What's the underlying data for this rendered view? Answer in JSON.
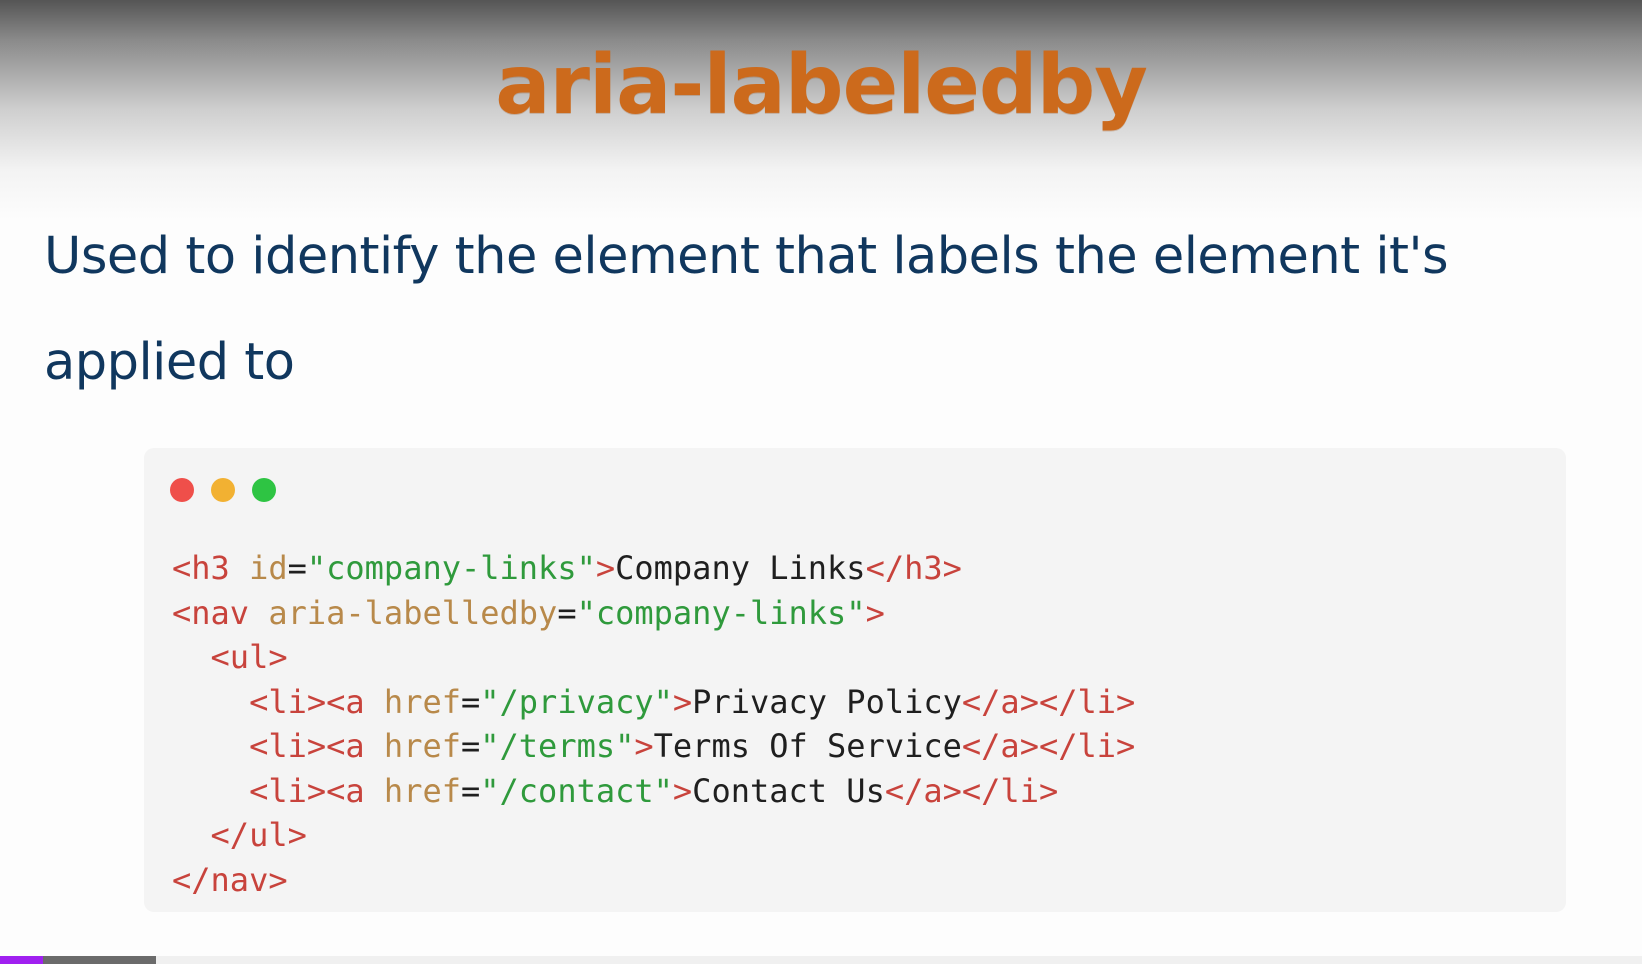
{
  "slide": {
    "title": "aria-labeledby",
    "description": "Used to identify the element that labels the element it's applied to"
  },
  "code_window": {
    "dots": [
      "red-dot",
      "yellow-dot",
      "green-dot"
    ],
    "colors": {
      "tag": "#c8433c",
      "attribute": "#b8894a",
      "string": "#2f9a3c",
      "text": "#1f1f1f"
    },
    "lines": [
      [
        {
          "k": "t",
          "v": "<h3 "
        },
        {
          "k": "a",
          "v": "id"
        },
        {
          "k": "p",
          "v": "="
        },
        {
          "k": "s",
          "v": "\"company-links\""
        },
        {
          "k": "t",
          "v": ">"
        },
        {
          "k": "x",
          "v": "Company Links"
        },
        {
          "k": "t",
          "v": "</h3>"
        }
      ],
      [
        {
          "k": "t",
          "v": "<nav "
        },
        {
          "k": "a",
          "v": "aria-labelledby"
        },
        {
          "k": "p",
          "v": "="
        },
        {
          "k": "s",
          "v": "\"company-links\""
        },
        {
          "k": "t",
          "v": ">"
        }
      ],
      [
        {
          "k": "x",
          "v": "  "
        },
        {
          "k": "t",
          "v": "<ul>"
        }
      ],
      [
        {
          "k": "x",
          "v": "    "
        },
        {
          "k": "t",
          "v": "<li><a "
        },
        {
          "k": "a",
          "v": "href"
        },
        {
          "k": "p",
          "v": "="
        },
        {
          "k": "s",
          "v": "\"/privacy\""
        },
        {
          "k": "t",
          "v": ">"
        },
        {
          "k": "x",
          "v": "Privacy Policy"
        },
        {
          "k": "t",
          "v": "</a></li>"
        }
      ],
      [
        {
          "k": "x",
          "v": "    "
        },
        {
          "k": "t",
          "v": "<li><a "
        },
        {
          "k": "a",
          "v": "href"
        },
        {
          "k": "p",
          "v": "="
        },
        {
          "k": "s",
          "v": "\"/terms\""
        },
        {
          "k": "t",
          "v": ">"
        },
        {
          "k": "x",
          "v": "Terms Of Service"
        },
        {
          "k": "t",
          "v": "</a></li>"
        }
      ],
      [
        {
          "k": "x",
          "v": "    "
        },
        {
          "k": "t",
          "v": "<li><a "
        },
        {
          "k": "a",
          "v": "href"
        },
        {
          "k": "p",
          "v": "="
        },
        {
          "k": "s",
          "v": "\"/contact\""
        },
        {
          "k": "t",
          "v": ">"
        },
        {
          "k": "x",
          "v": "Contact Us"
        },
        {
          "k": "t",
          "v": "</a></li>"
        }
      ],
      [
        {
          "k": "x",
          "v": "  "
        },
        {
          "k": "t",
          "v": "</ul>"
        }
      ],
      [
        {
          "k": "t",
          "v": "</nav>"
        }
      ]
    ]
  },
  "video_progress": {
    "played_fraction": 0.026,
    "buffered_fraction": 0.095,
    "played_color": "#a020f0",
    "buffered_color": "#6b6b6b"
  }
}
